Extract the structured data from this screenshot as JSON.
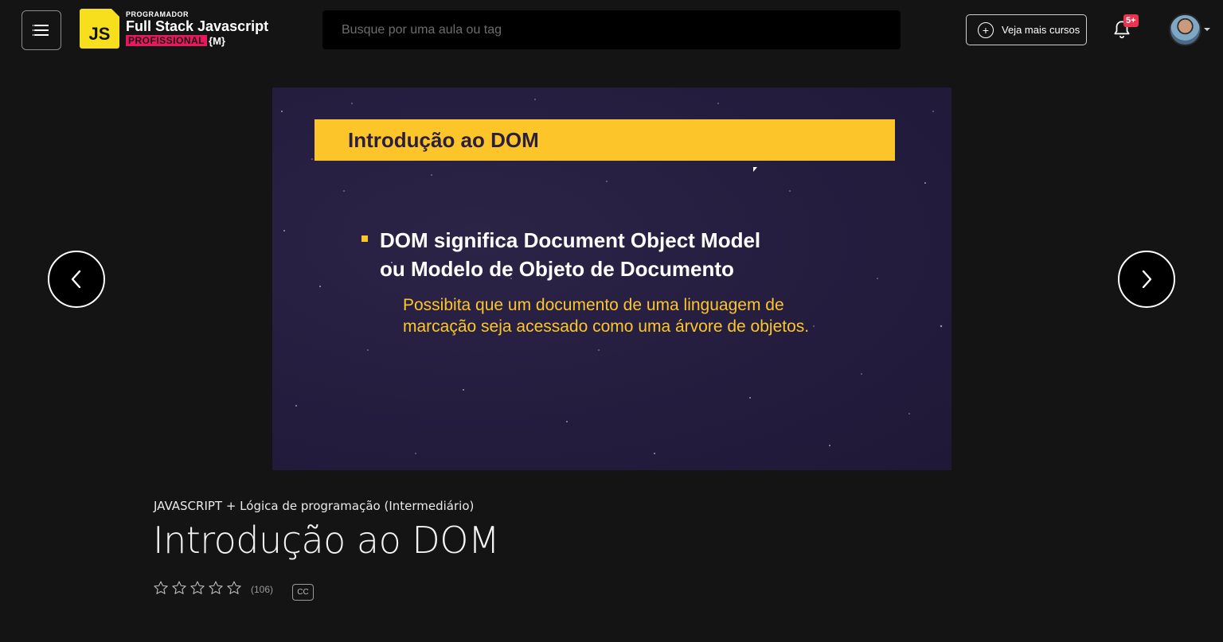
{
  "header": {
    "logo": {
      "badge": "JS",
      "top_line": "PROGRAMADOR",
      "main_line": "Full Stack Javascript",
      "tag": "PROFISSIONAL",
      "brace": "{M}"
    },
    "search": {
      "placeholder": "Busque por uma aula ou tag",
      "value": ""
    },
    "more_courses_label": "Veja mais cursos",
    "notifications_badge": "5+"
  },
  "player": {
    "slide": {
      "banner": "Introdução ao DOM",
      "main_line_1": "DOM significa Document Object Model",
      "main_line_2": "ou Modelo de Objeto de Documento",
      "sub_line_1": "Possibita que um documento de uma linguagem de",
      "sub_line_2": "marcação seja acessado como uma árvore de objetos."
    }
  },
  "lesson": {
    "course": "JAVASCRIPT + Lógica de programação (Intermediário)",
    "title": "Introdução ao DOM",
    "rating": {
      "stars": 5,
      "filled": 0,
      "count": "(106)"
    },
    "cc_label": "CC"
  },
  "colors": {
    "background": "#141414",
    "accent_yellow": "#fcc62a",
    "brand_pink": "#e6195e",
    "badge_red": "#e8344e"
  },
  "icons": [
    "hamburger-menu-icon",
    "plus-circle-icon",
    "bell-icon",
    "chevron-left-icon",
    "chevron-right-icon",
    "star-outline-icon",
    "caret-down-icon"
  ]
}
